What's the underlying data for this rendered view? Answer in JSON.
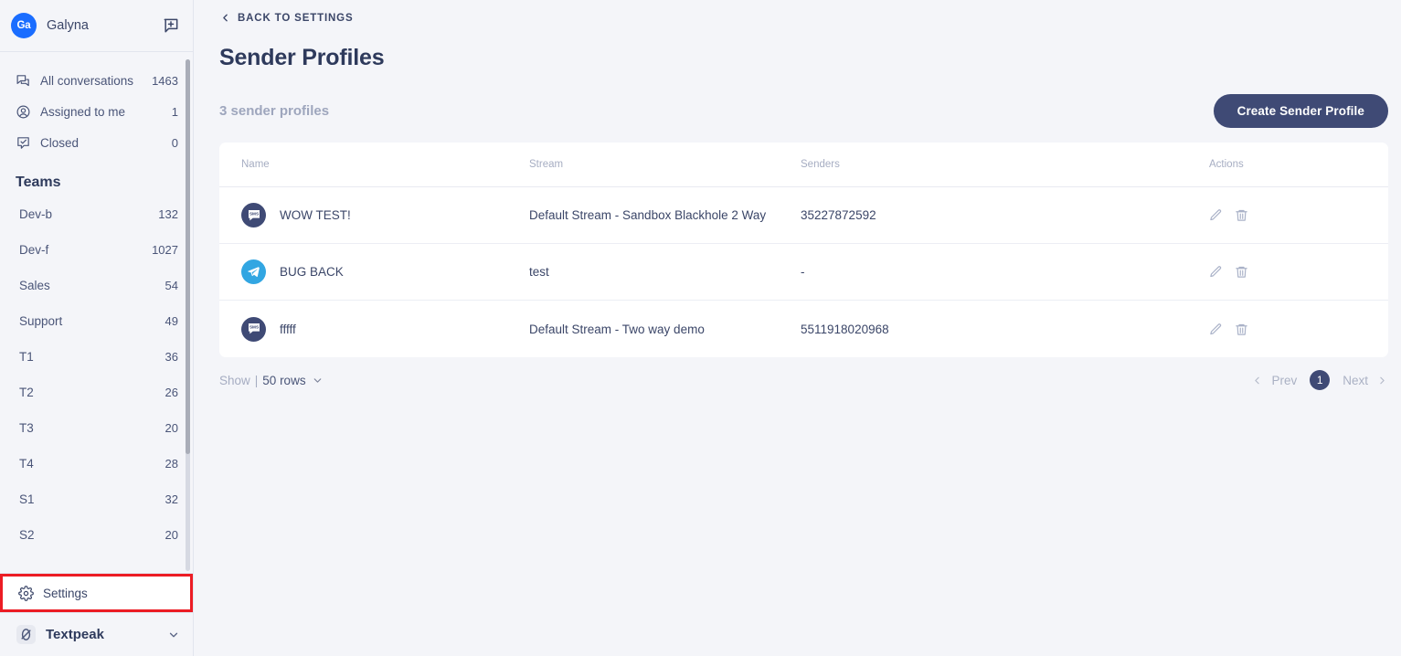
{
  "sidebar": {
    "user": {
      "initials": "Ga",
      "name": "Galyna"
    },
    "new_message_icon": "new-message-icon",
    "nav": [
      {
        "icon": "conversations-icon",
        "label": "All conversations",
        "count": "1463"
      },
      {
        "icon": "assigned-user-icon",
        "label": "Assigned to me",
        "count": "1"
      },
      {
        "icon": "closed-check-icon",
        "label": "Closed",
        "count": "0"
      }
    ],
    "teams_title": "Teams",
    "teams": [
      {
        "label": "Dev-b",
        "count": "132"
      },
      {
        "label": "Dev-f",
        "count": "1027"
      },
      {
        "label": "Sales",
        "count": "54"
      },
      {
        "label": "Support",
        "count": "49"
      },
      {
        "label": "T1",
        "count": "36"
      },
      {
        "label": "T2",
        "count": "26"
      },
      {
        "label": "T3",
        "count": "20"
      },
      {
        "label": "T4",
        "count": "28"
      },
      {
        "label": "S1",
        "count": "32"
      },
      {
        "label": "S2",
        "count": "20"
      }
    ],
    "settings": {
      "label": "Settings",
      "icon": "gear-icon",
      "highlight_color": "#ec1c24"
    },
    "brand": {
      "name": "Textpeak",
      "mark": "textpeak-logo-icon",
      "chevron": "chevron-down-icon"
    }
  },
  "main": {
    "back_link": "BACK TO SETTINGS",
    "title": "Sender Profiles",
    "count_text": "3 sender profiles",
    "create_button": "Create Sender Profile",
    "table": {
      "columns": [
        "Name",
        "Stream",
        "Senders",
        "Actions"
      ],
      "rows": [
        {
          "channel_icon": "sms-channel-icon",
          "name": "WOW TEST!",
          "stream": "Default Stream - Sandbox Blackhole 2 Way",
          "senders": "35227872592"
        },
        {
          "channel_icon": "telegram-channel-icon",
          "name": "BUG BACK",
          "stream": "test",
          "senders": "-"
        },
        {
          "channel_icon": "sms-channel-icon",
          "name": "fffff",
          "stream": "Default Stream - Two way demo",
          "senders": "5511918020968"
        }
      ],
      "action_icons": [
        "edit-pencil-icon",
        "delete-trash-icon"
      ]
    },
    "footer": {
      "show_label": "Show",
      "separator": "|",
      "rows_value": "50 rows",
      "prev_label": "Prev",
      "current_page": "1",
      "next_label": "Next"
    }
  },
  "colors": {
    "accent_navy": "#3f4a75",
    "brand_blue": "#1a6dff",
    "telegram_blue": "#32a6e2",
    "highlight_red": "#ec1c24",
    "page_bg": "#f4f5f9"
  }
}
